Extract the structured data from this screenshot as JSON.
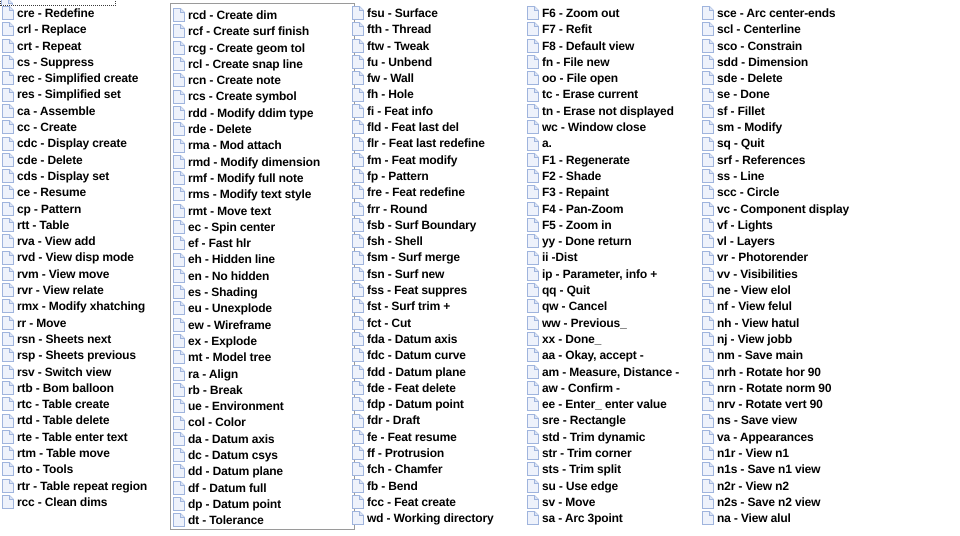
{
  "window": {
    "background_color": "#ffffff",
    "text_color": "#000000",
    "icon_name": "document-icon",
    "icon_fill": "#eef2fb",
    "icon_stroke": "#9fb4dd",
    "frame_color": "#9a9a9a",
    "selection_border_color": "#3a3a3a"
  },
  "partial_row": {
    "label": ""
  },
  "columns": [
    {
      "name": "column-1",
      "framed": false,
      "items": [
        "cre - Redefine",
        "crl - Replace",
        "crt - Repeat",
        "cs - Suppress",
        "rec - Simplified create",
        "res - Simplified set",
        "ca - Assemble",
        "cc - Create",
        "cdc - Display create",
        "cde - Delete",
        "cds - Display set",
        "ce - Resume",
        "cp - Pattern",
        "rtt - Table",
        "rva - View add",
        "rvd - View disp mode",
        "rvm - View move",
        "rvr - View relate",
        "rmx - Modify xhatching",
        "rr - Move",
        "rsn - Sheets next",
        "rsp - Sheets previous",
        "rsv - Switch view",
        "rtb - Bom balloon",
        "rtc - Table create",
        "rtd - Table delete",
        "rte - Table enter text",
        "rtm - Table move",
        "rto - Tools",
        "rtr - Table repeat region",
        "rcc - Clean dims"
      ]
    },
    {
      "name": "column-2",
      "framed": true,
      "items": [
        "rcd - Create dim",
        "rcf - Create surf finish",
        "rcg - Create geom tol",
        "rcl - Create snap line",
        "rcn - Create note",
        "rcs - Create symbol",
        "rdd - Modify ddim type",
        "rde - Delete",
        "rma - Mod attach",
        "rmd - Modify dimension",
        "rmf - Modify full note",
        "rms - Modify text style",
        "rmt - Move text",
        "ec - Spin center",
        "ef - Fast hlr",
        "eh - Hidden line",
        "en - No hidden",
        "es - Shading",
        "eu - Unexplode",
        "ew - Wireframe",
        "ex - Explode",
        "mt - Model tree",
        "ra - Align",
        "rb - Break",
        "ue - Environment",
        "col - Color",
        "da - Datum axis",
        "dc - Datum csys",
        "dd - Datum plane",
        "df - Datum full",
        "dp - Datum point",
        "dt - Tolerance"
      ]
    },
    {
      "name": "column-3",
      "framed": false,
      "items": [
        "fsu - Surface",
        "fth - Thread",
        "ftw - Tweak",
        "fu - Unbend",
        "fw - Wall",
        "fh - Hole",
        "fi - Feat info",
        "fld - Feat last del",
        "flr - Feat last redefine",
        "fm - Feat modify",
        "fp - Pattern",
        "fre - Feat redefine",
        "frr - Round",
        "fsb - Surf Boundary",
        "fsh - Shell",
        "fsm - Surf merge",
        "fsn - Surf new",
        "fss - Feat suppres",
        "fst - Surf trim +",
        "fct - Cut",
        "fda - Datum axis",
        "fdc - Datum curve",
        "fdd - Datum plane",
        "fde - Feat delete",
        "fdp - Datum point",
        "fdr - Draft",
        "fe - Feat resume",
        "ff - Protrusion",
        "fch - Chamfer",
        "fb - Bend",
        "fcc - Feat create",
        "wd - Working directory"
      ]
    },
    {
      "name": "column-4",
      "framed": false,
      "items": [
        "F6 - Zoom out",
        "F7 - Refit",
        "F8 - Default view",
        "fn - File new",
        "oo - File open",
        "tc - Erase current",
        "tn - Erase not displayed",
        "wc - Window close",
        "a.",
        "F1 - Regenerate",
        "F2 - Shade",
        "F3 - Repaint",
        "F4 - Pan-Zoom",
        "F5 - Zoom in",
        "yy - Done return",
        "ii -Dist",
        "ip - Parameter, info +",
        "qq - Quit",
        "qw - Cancel",
        "ww - Previous_",
        "xx - Done_",
        "aa - Okay, accept -",
        "am - Measure, Distance -",
        "aw - Confirm -",
        "ee - Enter_ enter value",
        "sre - Rectangle",
        "std - Trim dynamic",
        "str - Trim corner",
        "sts - Trim split",
        "su - Use edge",
        "sv - Move",
        "sa - Arc 3point"
      ]
    },
    {
      "name": "column-5",
      "framed": false,
      "items": [
        "sce - Arc center-ends",
        "scl - Centerline",
        "sco - Constrain",
        "sdd - Dimension",
        "sde - Delete",
        "se - Done",
        "sf - Fillet",
        "sm - Modify",
        "sq - Quit",
        "srf - References",
        "ss - Line",
        "scc - Circle",
        "vc - Component display",
        "vf - Lights",
        "vl - Layers",
        "vr - Photorender",
        "vv - Visibilities",
        "ne - View elol",
        "nf - View felul",
        "nh - View hatul",
        "nj - View jobb",
        "nm - Save main",
        "nrh - Rotate hor 90",
        "nrn - Rotate norm 90",
        "nrv - Rotate vert 90",
        "ns - Save view",
        "va - Appearances",
        "n1r - View n1",
        "n1s - Save n1 view",
        "n2r - View n2",
        "n2s - Save n2 view",
        "na - View alul"
      ]
    }
  ]
}
